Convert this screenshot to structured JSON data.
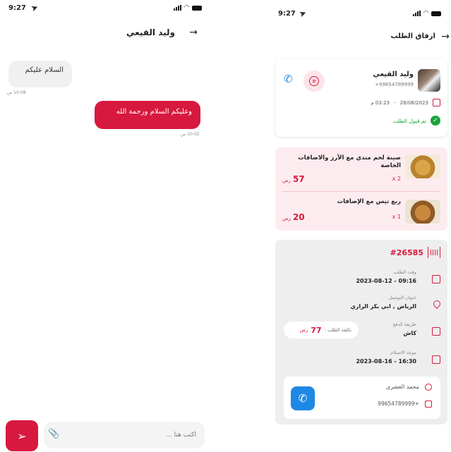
{
  "left": {
    "status_time": "9:27",
    "header": {
      "title": "وليد القيعي"
    },
    "messages": [
      {
        "text": "السلام عليكم",
        "time": "10:08 ص"
      },
      {
        "text": "وعليكم السلام ورحمة الله",
        "time": "10:02 ص"
      }
    ],
    "composer": {
      "placeholder": "اكتب هنا ..."
    }
  },
  "right": {
    "status_time": "9:27",
    "header": {
      "title": "ارفاق الطلب"
    },
    "customer": {
      "name": "وليد القيعي",
      "phone": "+99654789999",
      "date": "28/08/2023",
      "separator": "-",
      "time": "03:23 م",
      "status": "تم قبول الطلب"
    },
    "items": [
      {
        "name": "صينة لحم مندي مع الأرز والاضافات الخاصة",
        "qty": "2 x",
        "price": "57",
        "currency": "رس"
      },
      {
        "name": "ربع تيس مع الإضافات",
        "qty": "1 x",
        "price": "20",
        "currency": "رس"
      }
    ],
    "order": {
      "id": "#26585",
      "order_time_label": "وقت الطلب",
      "order_time_value": "09:16 - 2023-08-12",
      "address_label": "عنوان التوصيل",
      "address_value": "الرياض , ابي بكر الرازي",
      "payment_label": "طريقة الدفع",
      "payment_value": "كاش",
      "cost_label": "تكلفة الطلب :",
      "cost_value": "77",
      "cost_currency": "رس",
      "delivery_label": "موعد الاستلام",
      "delivery_value": "16:30 - 2023-08-16",
      "driver_name": "محمد العشري",
      "driver_phone": "+99654789999"
    }
  },
  "colors": {
    "accent": "#d7193f",
    "blue": "#1e88e5",
    "green": "#1aa33a"
  }
}
